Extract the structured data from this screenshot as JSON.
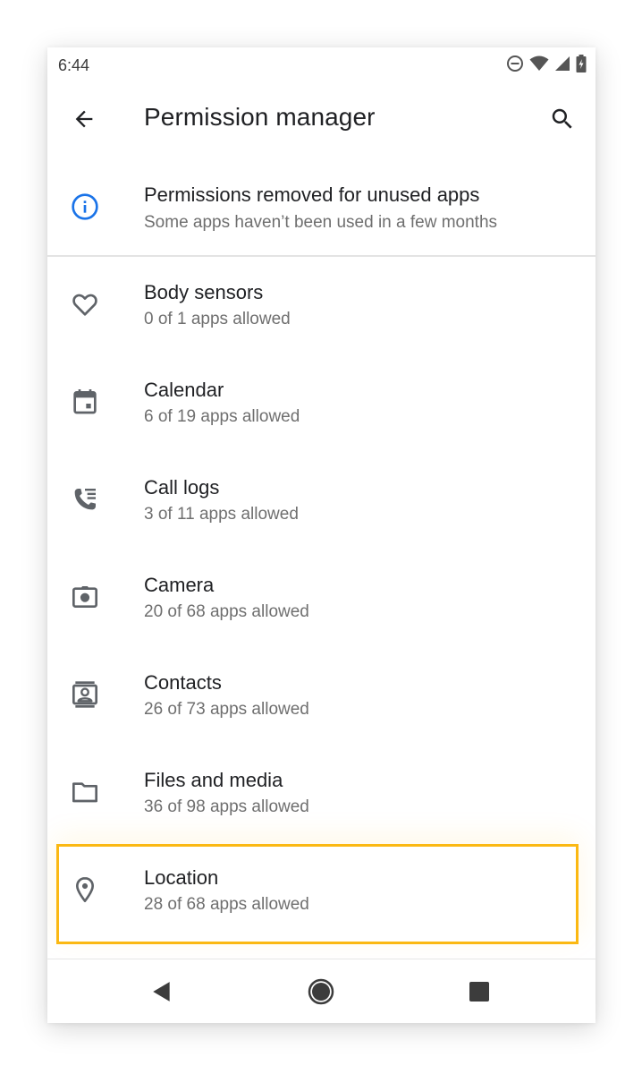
{
  "status_bar": {
    "time": "6:44",
    "icons": [
      "do-not-disturb-icon",
      "wifi-icon",
      "cell-signal-icon",
      "battery-charging-icon"
    ]
  },
  "app_bar": {
    "back_icon": "arrow-back-icon",
    "title": "Permission manager",
    "search_icon": "search-icon"
  },
  "notice": {
    "icon": "info-icon",
    "title": "Permissions removed for unused apps",
    "subtitle": "Some apps haven’t been used in a few months",
    "icon_color": "#1a73e8"
  },
  "permissions": [
    {
      "icon": "heart-icon",
      "label": "Body sensors",
      "summary": "0 of 1 apps allowed"
    },
    {
      "icon": "calendar-icon",
      "label": "Calendar",
      "summary": "6 of 19 apps allowed"
    },
    {
      "icon": "call-log-icon",
      "label": "Call logs",
      "summary": "3 of 11 apps allowed"
    },
    {
      "icon": "camera-icon",
      "label": "Camera",
      "summary": "20 of 68 apps allowed"
    },
    {
      "icon": "contacts-icon",
      "label": "Contacts",
      "summary": "26 of 73 apps allowed"
    },
    {
      "icon": "folder-icon",
      "label": "Files and media",
      "summary": "36 of 98 apps allowed"
    },
    {
      "icon": "location-pin-icon",
      "label": "Location",
      "summary": "28 of 68 apps allowed",
      "highlighted": true
    }
  ],
  "highlight_color": "#fbb812",
  "nav_bar": {
    "back_icon": "nav-back-triangle-icon",
    "home_icon": "nav-home-circle-icon",
    "recents_icon": "nav-recents-square-icon"
  }
}
